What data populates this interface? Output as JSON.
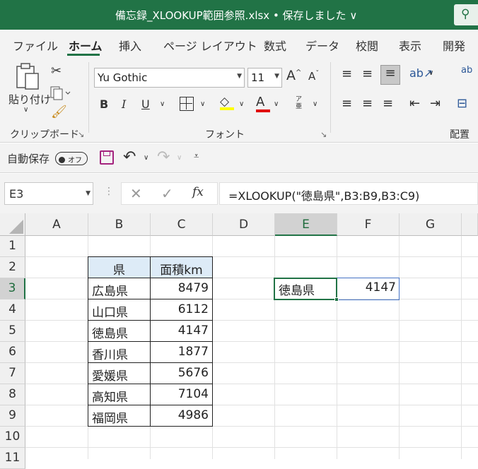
{
  "title": "備忘録_XLOOKUP範囲参照.xlsx • 保存しました ∨",
  "tabs": [
    "ファイル",
    "ホーム",
    "挿入",
    "ページ レイアウト",
    "数式",
    "データ",
    "校閲",
    "表示",
    "開発"
  ],
  "ribbon": {
    "paste_label": "貼り付け",
    "font_name": "Yu Gothic",
    "font_size": "11",
    "groups": {
      "clipboard": "クリップボード",
      "font": "フォント",
      "alignment": "配置"
    }
  },
  "qat": {
    "autosave_label": "自動保存",
    "toggle_label": "オフ"
  },
  "formula_bar": {
    "name_box": "E3",
    "fx": "fx",
    "formula": "=XLOOKUP(\"徳島県\",B3:B9,B3:C9)"
  },
  "sheet": {
    "columns": [
      "A",
      "B",
      "C",
      "D",
      "E",
      "F",
      "G"
    ],
    "rows": [
      "1",
      "2",
      "3",
      "4",
      "5",
      "6",
      "7",
      "8",
      "9",
      "10",
      "11"
    ],
    "table_header": [
      "県",
      "面積km"
    ],
    "table_rows": [
      [
        "広島県",
        "8479"
      ],
      [
        "山口県",
        "6112"
      ],
      [
        "徳島県",
        "4147"
      ],
      [
        "香川県",
        "1877"
      ],
      [
        "愛媛県",
        "5676"
      ],
      [
        "高知県",
        "7104"
      ],
      [
        "福岡県",
        "4986"
      ]
    ],
    "result": [
      "徳島県",
      "4147"
    ]
  },
  "colors": {
    "accent": "#217346",
    "table_header_fill": "#ddebf7",
    "spill_border": "#4472c4"
  }
}
